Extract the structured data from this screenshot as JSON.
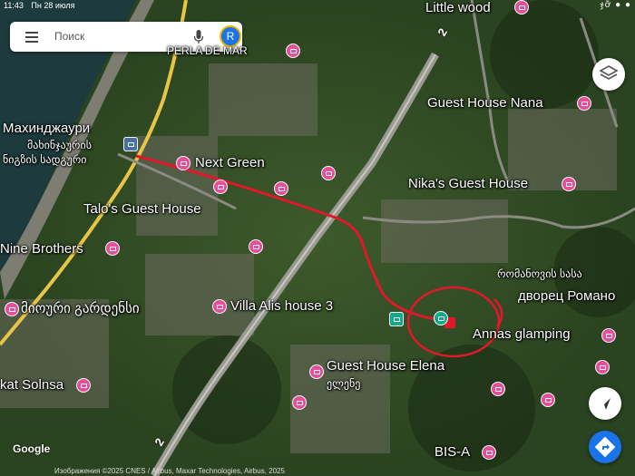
{
  "status_bar": {
    "time": "11:43",
    "date": "Пн 28 июля",
    "right_text": "ჯỡ ● ●"
  },
  "search": {
    "placeholder": "Поиск",
    "avatar_letter": "R"
  },
  "map": {
    "places": [
      {
        "id": "little-wood",
        "name": "Little wood"
      },
      {
        "id": "perla-de-mar",
        "name": "PERLA DE MAR"
      },
      {
        "id": "makhinjauri",
        "name": "Махинджаури"
      },
      {
        "id": "makhinjauri-ka",
        "name": "მახინჯაურის"
      },
      {
        "id": "station-ka",
        "name": "ნიგზის სადგური"
      },
      {
        "id": "guest-house-nana",
        "name": "Guest House Nana"
      },
      {
        "id": "next-green",
        "name": "Next Green"
      },
      {
        "id": "nikas-guest-house",
        "name": "Nika's Guest House"
      },
      {
        "id": "talos-guest-house",
        "name": "Talo's Guest House"
      },
      {
        "id": "nine-brothers",
        "name": "Nine Brothers"
      },
      {
        "id": "romanov-ka",
        "name": "რომანოვის სასა"
      },
      {
        "id": "romanov-ru",
        "name": "дворец Романо"
      },
      {
        "id": "miouri-gardens",
        "name": "მიოური გარდენსი"
      },
      {
        "id": "villa-alis",
        "name": "Villa Alis house 3"
      },
      {
        "id": "annas-glamping",
        "name": "Annas glamping"
      },
      {
        "id": "guest-house-elena",
        "name": "Guest House Elena"
      },
      {
        "id": "elena-ka",
        "name": "ელენე"
      },
      {
        "id": "kat-solnsa",
        "name": "kat Solnsa"
      },
      {
        "id": "bis-a",
        "name": "BIS-A"
      }
    ],
    "road_shield": "2",
    "colors": {
      "route": "#e0182b",
      "pin": "#e34f9b",
      "satellite_base": "#2b4220"
    }
  },
  "footer": {
    "google_logo": "Google",
    "attribution": "Изображения ©2025 CNES / Airbus, Maxar Technologies, Airbus, 2025"
  },
  "icons": [
    "menu-icon",
    "mic-icon",
    "layers-icon",
    "compass-icon",
    "directions-icon",
    "hotel-pin-icon"
  ]
}
